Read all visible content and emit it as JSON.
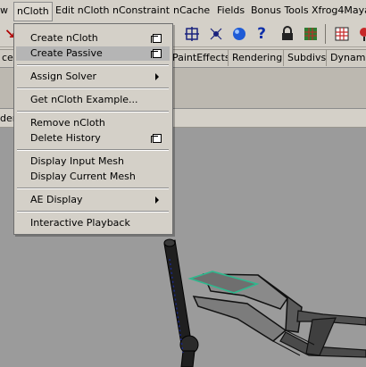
{
  "menubar": {
    "items": [
      "w",
      "nCloth",
      "Edit nCloth",
      "nConstraint",
      "nCache",
      "Fields",
      "Bonus Tools",
      "Xfrog4Maya"
    ]
  },
  "shelf_tabs": [
    "ces",
    "PaintEffects",
    "Rendering",
    "Subdivs",
    "Dynamic"
  ],
  "panel_left_text": "der",
  "dropdown": {
    "create_ncloth": "Create nCloth",
    "create_passive": "Create Passive",
    "assign_solver": "Assign Solver",
    "get_example": "Get nCloth Example...",
    "remove_ncloth": "Remove nCloth",
    "delete_history": "Delete History",
    "display_input_mesh": "Display Input Mesh",
    "display_current_mesh": "Display Current Mesh",
    "ae_display": "AE Display",
    "interactive_playback": "Interactive Playback"
  },
  "toolbar_icons": [
    "lattice-icon",
    "spider-icon",
    "sphere-icon",
    "help-icon",
    "lock-icon",
    "grid-icon",
    "render-icon",
    "marker-icon"
  ]
}
